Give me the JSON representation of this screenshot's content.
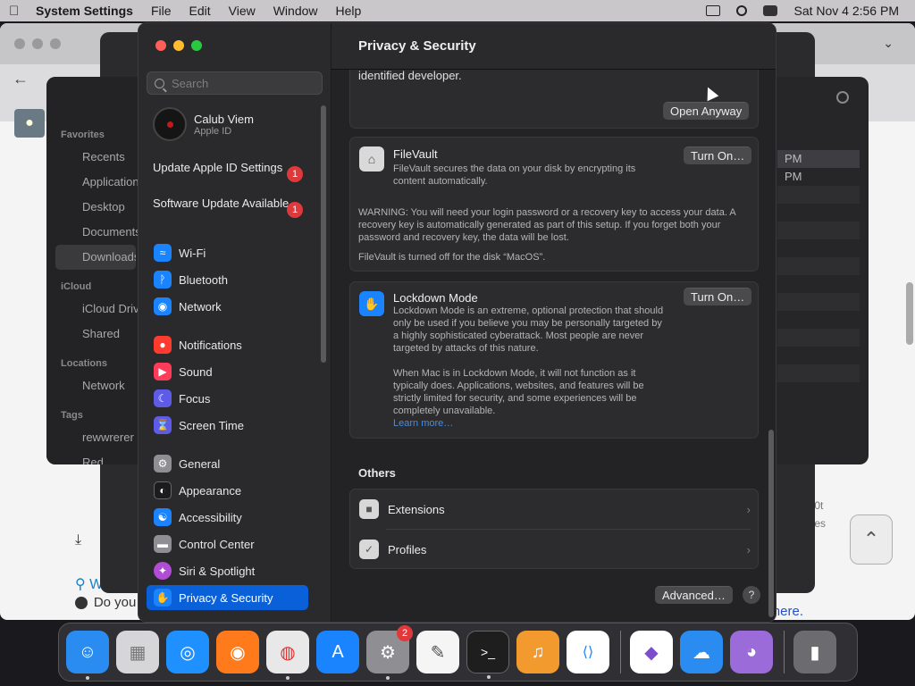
{
  "menubar": {
    "app": "System Settings",
    "items": [
      "File",
      "Edit",
      "View",
      "Window",
      "Help"
    ],
    "clock": "Sat Nov 4  2:56 PM"
  },
  "browser": {
    "link_text": "here.",
    "footer_text": "Do you",
    "search_text": "W",
    "rows": [
      "0t",
      "es"
    ]
  },
  "finder": {
    "favorites_label": "Favorites",
    "favorites": [
      "Recents",
      "Applications",
      "Desktop",
      "Documents",
      "Downloads"
    ],
    "icloud_label": "iCloud",
    "icloud": [
      "iCloud Drive",
      "Shared"
    ],
    "locations_label": "Locations",
    "locations": [
      "Network"
    ],
    "tags_label": "Tags",
    "tags": [
      "rewwrerer",
      "Red"
    ],
    "rows": [
      "PM",
      "PM"
    ]
  },
  "sidebar": {
    "search_placeholder": "Search",
    "account_name": "Calub Viem",
    "account_sub": "Apple ID",
    "updates": [
      {
        "label": "Update Apple ID Settings",
        "badge": "1"
      },
      {
        "label": "Software Update Available",
        "badge": "1"
      }
    ],
    "items": [
      {
        "label": "Wi-Fi",
        "icon": "wifi-icon",
        "color": "#1a84ff"
      },
      {
        "label": "Bluetooth",
        "icon": "bluetooth-icon",
        "color": "#1a84ff"
      },
      {
        "label": "Network",
        "icon": "globe-icon",
        "color": "#1a84ff"
      },
      {
        "label": "Notifications",
        "icon": "bell-icon",
        "color": "#ff3b30"
      },
      {
        "label": "Sound",
        "icon": "speaker-icon",
        "color": "#ff3b5a"
      },
      {
        "label": "Focus",
        "icon": "moon-icon",
        "color": "#5e5ce6"
      },
      {
        "label": "Screen Time",
        "icon": "hourglass-icon",
        "color": "#5e5ce6"
      },
      {
        "label": "General",
        "icon": "gear-icon",
        "color": "#8e8e93"
      },
      {
        "label": "Appearance",
        "icon": "appearance-icon",
        "color": "#1c1c1e"
      },
      {
        "label": "Accessibility",
        "icon": "accessibility-icon",
        "color": "#1a84ff"
      },
      {
        "label": "Control Center",
        "icon": "control-center-icon",
        "color": "#8e8e93"
      },
      {
        "label": "Siri & Spotlight",
        "icon": "siri-icon",
        "color": "#b14cd6"
      },
      {
        "label": "Privacy & Security",
        "icon": "hand-icon",
        "color": "#1a84ff"
      }
    ]
  },
  "content": {
    "title": "Privacy & Security",
    "top_card_text": "identified developer.",
    "open_anyway": "Open Anyway",
    "filevault": {
      "title": "FileVault",
      "desc": "FileVault secures the data on your disk by encrypting its content automatically.",
      "button": "Turn On…",
      "warning": "WARNING: You will need your login password or a recovery key to access your data. A recovery key is automatically generated as part of this setup. If you forget both your password and recovery key, the data will be lost.",
      "status": "FileVault is turned off for the disk “MacOS”."
    },
    "lockdown": {
      "title": "Lockdown Mode",
      "desc": "Lockdown Mode is an extreme, optional protection that should only be used if you believe you may be personally targeted by a highly sophisticated cyberattack. Most people are never targeted by attacks of this nature.",
      "desc2": "When Mac is in Lockdown Mode, it will not function as it typically does. Applications, websites, and features will be strictly limited for security, and some experiences will be completely unavailable.",
      "link": "Learn more…",
      "button": "Turn On…"
    },
    "others_label": "Others",
    "others": [
      {
        "label": "Extensions",
        "icon": "extensions-icon"
      },
      {
        "label": "Profiles",
        "icon": "profiles-icon"
      }
    ],
    "advanced": "Advanced…",
    "help": "?"
  },
  "dock": {
    "apps": [
      {
        "name": "finder",
        "color": "#2a8cf0",
        "glyph": "☺",
        "dot": true
      },
      {
        "name": "launchpad",
        "color": "#d6d6d8",
        "glyph": "▦",
        "dot": false
      },
      {
        "name": "safari",
        "color": "#1e90ff",
        "glyph": "◎",
        "dot": false
      },
      {
        "name": "firefox",
        "color": "#ff7a1a",
        "glyph": "◉",
        "dot": false
      },
      {
        "name": "chrome",
        "color": "#e8e8e8",
        "glyph": "◍",
        "dot": true
      },
      {
        "name": "app-store",
        "color": "#1a84ff",
        "glyph": "A",
        "dot": false
      },
      {
        "name": "system-settings",
        "color": "#8e8e93",
        "glyph": "⚙",
        "dot": true,
        "badge": "2"
      },
      {
        "name": "textedit",
        "color": "#f5f5f5",
        "glyph": "✎",
        "dot": false
      },
      {
        "name": "terminal",
        "color": "#1e1e1e",
        "glyph": ">_",
        "dot": true
      },
      {
        "name": "garageband",
        "color": "#f29a2e",
        "glyph": "♫",
        "dot": false
      },
      {
        "name": "vscode",
        "color": "#ffffff",
        "glyph": "⟨⟩",
        "dot": false
      }
    ],
    "apps2": [
      {
        "name": "visual-studio",
        "color": "#ffffff",
        "glyph": "◆",
        "dot": false
      },
      {
        "name": "weather",
        "color": "#2a8cf0",
        "glyph": "☁",
        "dot": false
      },
      {
        "name": "disk-utility",
        "color": "#9a6bd9",
        "glyph": "◕",
        "dot": false
      }
    ],
    "trash": {
      "name": "trash",
      "color": "#6c6c70",
      "glyph": "▮"
    }
  }
}
